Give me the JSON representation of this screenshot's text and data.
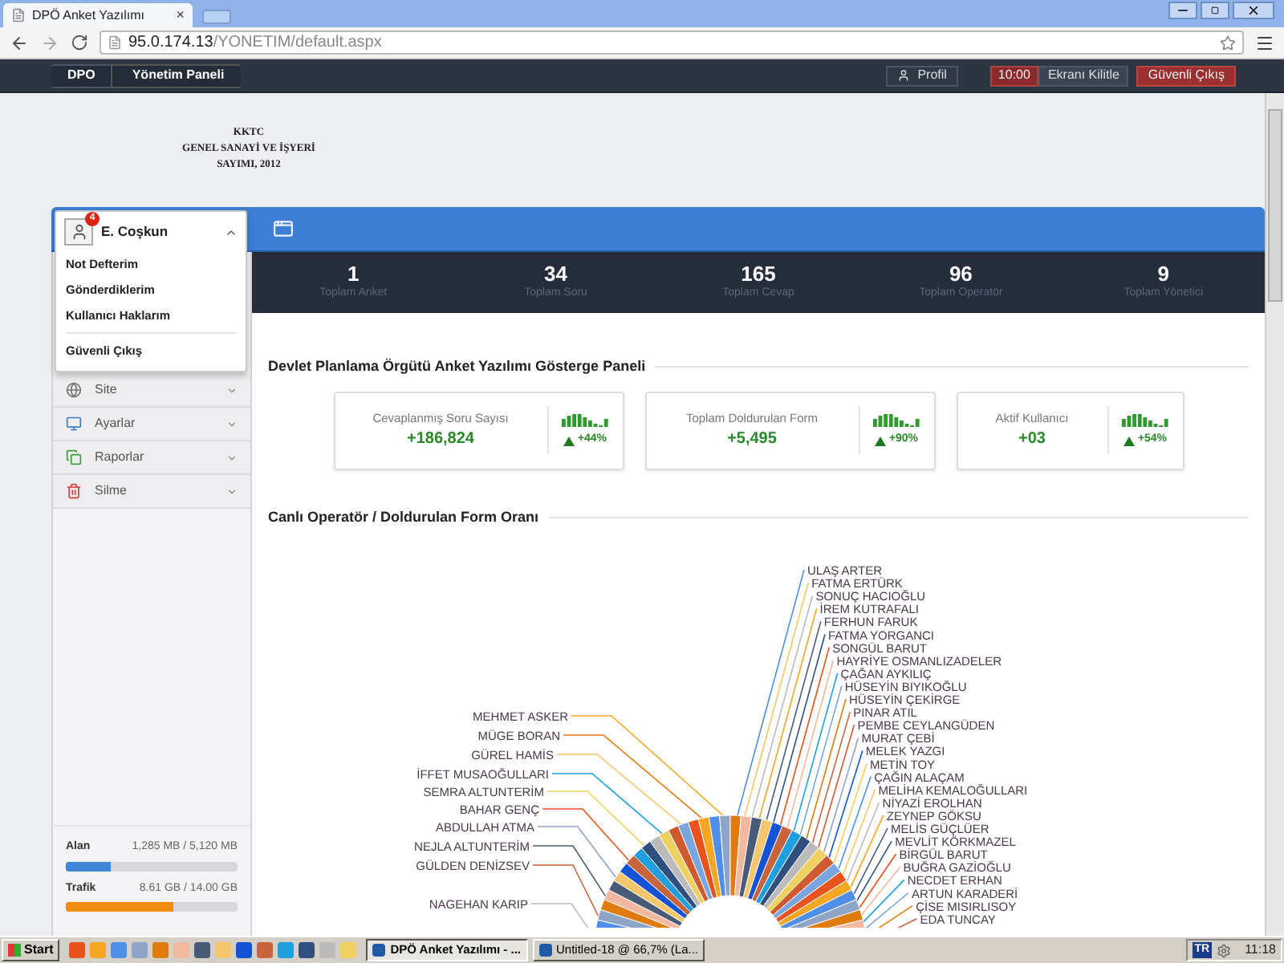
{
  "browser": {
    "tab_title": "DPÖ Anket Yazılımı",
    "tab_close": "×",
    "url_host": "95.0.174.13",
    "url_path": "/YONETIM/default.aspx"
  },
  "navbar": {
    "breadcrumb": [
      "DPO",
      "Yönetim Paneli"
    ],
    "profile": "Profil",
    "lock_timer": "10:00",
    "lock": "Ekranı Kilitle",
    "logout": "Güvenli Çıkış"
  },
  "logo": [
    "KKTC",
    "GENEL SANAYİ VE İŞYERİ",
    "SAYIMI, 2012"
  ],
  "user_menu": {
    "name": "E. Coşkun",
    "badge": "4",
    "expanded": true,
    "items": [
      "Not Defterim",
      "Gönderdiklerim",
      "Kullanıcı Haklarım"
    ],
    "logout": "Güvenli Çıkış"
  },
  "sidebar": {
    "items": [
      "Site",
      "Ayarlar",
      "Raporlar",
      "Silme"
    ],
    "usage": [
      {
        "label": "Alan",
        "reading": "1,285 MB / 5,120 MB",
        "level": 0.26,
        "color": "#3f86d8"
      },
      {
        "label": "Trafik",
        "reading": "8.61 GB / 14.00 GB",
        "level": 0.63,
        "color": "#f08c10"
      }
    ]
  },
  "stats": [
    {
      "value": "1",
      "label": "Toplam Anket"
    },
    {
      "value": "34",
      "label": "Toplam Soru"
    },
    {
      "value": "165",
      "label": "Toplam Cevap"
    },
    {
      "value": "96",
      "label": "Toplam Operatör"
    },
    {
      "value": "9",
      "label": "Toplam Yönetici"
    }
  ],
  "dashboard": {
    "title": "Devlet Planlama Örgütü Anket Yazılımı Gösterge Paneli",
    "cards": [
      {
        "label": "Cevaplanmış Soru Sayısı",
        "value": "+186,824",
        "change": "+44%"
      },
      {
        "label": "Toplam Doldurulan Form",
        "value": "+5,495",
        "change": "+90%"
      },
      {
        "label": "Aktif Kullanıcı",
        "value": "+03",
        "change": "+54%"
      }
    ]
  },
  "chart": {
    "title": "Canlı Operatör / Doldurulan Form Oranı",
    "left_labels": [
      "MEHMET ASKER",
      "MÜGE BORAN",
      "GÜREL HAMİS",
      "İFFET MUSAOĞULLARI",
      "SEMRA ALTUNTERİM",
      "BAHAR GENÇ",
      "ABDULLAH ATMA",
      "NEJLA ALTUNTERİM",
      "GÜLDEN DENİZSEV",
      "NAGEHAN KARIP"
    ],
    "right_labels": [
      "ULAŞ ARTER",
      "FATMA ERTÜRK",
      "SONUÇ HACIOĞLU",
      "İREM KUTRAFALI",
      "FERHUN FARUK",
      "FATMA YORGANCI",
      "SONGÜL BARUT",
      "HAYRİYE OSMANLIZADELER",
      "ÇAĞAN AYKILIÇ",
      "HÜSEYİN BIYIKOĞLU",
      "HÜSEYİN ÇEKİRGE",
      "PINAR ATIL",
      "PEMBE CEYLANGÜDEN",
      "MURAT ÇEBİ",
      "MELEK YAZGI",
      "METİN TOY",
      "ÇAĞIN ALAÇAM",
      "MELİHA KEMALOĞULLARI",
      "NİYAZİ EROLHAN",
      "ZEYNEP GÖKSU",
      "MELİS GÜÇLÜER",
      "MEVLİT KÖRKMAZEL",
      "BİRGÜL BARUT",
      "BUĞRA GAZİOĞLU",
      "NECDET ERHAN",
      "ARTUN KARADERİ",
      "ÇİSE MISIRLISOY",
      "EDA TUNCAY"
    ]
  },
  "taskbar": {
    "start": "Start",
    "tasks": [
      {
        "label": "DPÖ Anket Yazılımı - ...",
        "selected": true
      },
      {
        "label": "Untitled-18 @ 66,7% (La...",
        "selected": false
      }
    ],
    "lang": "TR",
    "clock": "11:18"
  }
}
